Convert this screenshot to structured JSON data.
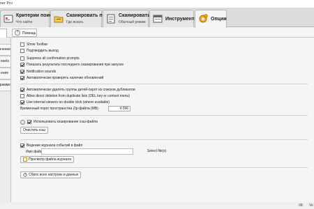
{
  "window": {
    "title": "ner Pro"
  },
  "tabs": [
    {
      "label": "Критерии поиска",
      "sub": "Что найти",
      "icon": "search-criteria-icon"
    },
    {
      "label": "Сканировать путь",
      "sub": "Где искать",
      "icon": "folder-scan-icon"
    },
    {
      "label": "Сканировать",
      "sub": "Обычный режим",
      "icon": "scan-icon"
    },
    {
      "label": "Инструменты",
      "sub": "",
      "icon": "tools-icon"
    },
    {
      "label": "Опции",
      "sub": "",
      "icon": "options-gear-icon"
    }
  ],
  "subbar": {
    "help_label": "Помощь"
  },
  "sidebar": {
    "items": [
      {
        "label": "ачение"
      },
      {
        "label": "esets"
      },
      {
        "label": "ение"
      },
      {
        "label": "ограмме"
      }
    ]
  },
  "options": {
    "show_toolbar": "Show Toolbar",
    "confirm_exit": "Подтвердить выход",
    "suppress_confirm": "Suppress all confirmation prompts",
    "show_last_scan": "Показать результаты последнего сканирования при запуске",
    "notification_sounds": "Notification sounds",
    "auto_update": "Автоматически проверять наличие обновлений",
    "auto_delete_orphans": "Автоматически удалять группы детей-сирот из списков дубликатов",
    "allow_direct_delete": "Allow direct deletion from duplicate lists (DEL key or context menu)",
    "use_internal_viewers": "Use internal viewers on double click (where available)",
    "zip_threshold_label": "Временный порог пространства Zip-файла (MB)",
    "zip_threshold_value": "4 096",
    "use_cache": "Использовать кэширование хэш-файла",
    "clear_cache": "Очистить кэш",
    "logging": "Ведение журнала событий в файл",
    "filename_label": "Имя файла",
    "filename_value": "",
    "select_files": "Select file(s)",
    "view_log": "Просмотр файла журнала",
    "reset_all": "Сброс всех настроек и данных"
  },
  "checks": {
    "show_toolbar": false,
    "confirm_exit": false,
    "suppress_confirm": false,
    "show_last_scan": true,
    "notification_sounds": true,
    "auto_update": true,
    "auto_delete_orphans": true,
    "allow_direct_delete": false,
    "use_internal_viewers": true,
    "use_cache": true,
    "logging": true
  },
  "status": {
    "left": "08:",
    "right": "Ve"
  }
}
